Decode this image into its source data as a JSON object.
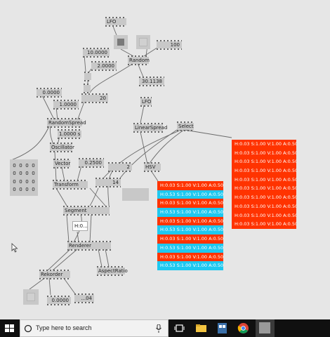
{
  "nodes": {
    "lfo_top": "LFO",
    "lfo_mid": "LFO",
    "val_100": "100",
    "val_10": "10.0000",
    "val_2": "2.0000",
    "random": "Random",
    "val_30": "30.1138",
    "val_20": "20",
    "val_0": "0.0000",
    "val_1": "1.0000",
    "random_spread": "RandomSpread",
    "val_1s": "1.0000 s",
    "oscillator": "Oscillator",
    "linear_spread": "LinearSpread",
    "select": "Select",
    "vector": "Vector",
    "val_025": "0.2500",
    "val_2b": "2",
    "hsv": "HSV",
    "transform": "Transform",
    "val_14": "14",
    "segment": "Segment",
    "text_node": "H:0...",
    "renderer": "Renderer",
    "aspect_ratio": "AspectRatio",
    "rekorder": "Rekorder",
    "val_0b": "0.0000",
    "val_04": "...04"
  },
  "matrix": [
    "0",
    "0",
    "0",
    "0",
    "0",
    "0",
    "0",
    "0",
    "0",
    "0",
    "0",
    "0",
    "0",
    "0",
    "0",
    "0"
  ],
  "color_list_left": [
    {
      "text": "H:0.03  S:1.00  V:1.00  A:0.50",
      "color": "#ff3300"
    },
    {
      "text": "H:0.53  S:1.00  V:1.00  A:0.50",
      "color": "#1ec8f0"
    },
    {
      "text": "H:0.03  S:1.00  V:1.00  A:0.50",
      "color": "#ff3300"
    },
    {
      "text": "H:0.53  S:1.00  V:1.00  A:0.50",
      "color": "#1ec8f0"
    },
    {
      "text": "H:0.03  S:1.00  V:1.00  A:0.50",
      "color": "#ff3300"
    },
    {
      "text": "H:0.53  S:1.00  V:1.00  A:0.50",
      "color": "#1ec8f0"
    },
    {
      "text": "H:0.03  S:1.00  V:1.00  A:0.50",
      "color": "#ff3300"
    },
    {
      "text": "H:0.53  S:1.00  V:1.00  A:0.50",
      "color": "#1ec8f0"
    },
    {
      "text": "H:0.03  S:1.00  V:1.00  A:0.50",
      "color": "#ff3300"
    },
    {
      "text": "H:0.53  S:1.00  V:1.00  A:0.50",
      "color": "#1ec8f0"
    }
  ],
  "color_list_right": [
    {
      "text": "H:0.03  S:1.00  V:1.00  A:0.50",
      "color": "#ff3300"
    },
    {
      "text": "H:0.03  S:1.00  V:1.00  A:0.50",
      "color": "#ff3300"
    },
    {
      "text": "H:0.03  S:1.00  V:1.00  A:0.50",
      "color": "#ff3300"
    },
    {
      "text": "H:0.03  S:1.00  V:1.00  A:0.50",
      "color": "#ff3300"
    },
    {
      "text": "H:0.03  S:1.00  V:1.00  A:0.50",
      "color": "#ff3300"
    },
    {
      "text": "H:0.03  S:1.00  V:1.00  A:0.50",
      "color": "#ff3300"
    },
    {
      "text": "H:0.03  S:1.00  V:1.00  A:0.50",
      "color": "#ff3300"
    },
    {
      "text": "H:0.03  S:1.00  V:1.00  A:0.50",
      "color": "#ff3300"
    },
    {
      "text": "H:0.03  S:1.00  V:1.00  A:0.50",
      "color": "#ff3300"
    },
    {
      "text": "H:0.03  S:1.00  V:1.00  A:0.50",
      "color": "#ff3300"
    }
  ],
  "taskbar": {
    "search_placeholder": "Type here to search",
    "icons": [
      "windows-start-icon",
      "search-icon",
      "microphone-icon",
      "task-view-icon",
      "file-explorer-icon",
      "store-icon",
      "chrome-icon",
      "app-window-icon"
    ]
  }
}
